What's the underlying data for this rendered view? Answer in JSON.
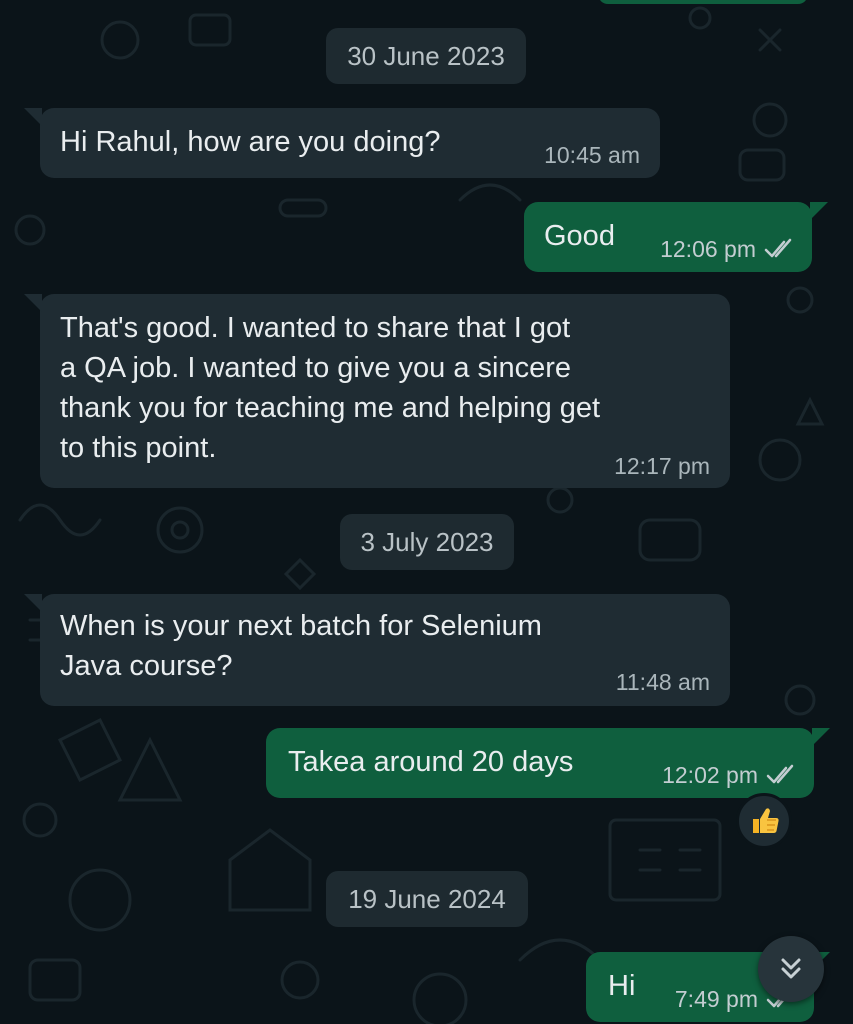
{
  "theme": {
    "background": "#0b1419",
    "incoming_bubble": "#1f2c33",
    "outgoing_bubble": "#0f5f3e",
    "date_chip": "#1e2a30",
    "text": "#e9edef",
    "meta_text": "#aab6bb",
    "tick_color": "#c3cdd1"
  },
  "dates": {
    "d1": "30 June 2023",
    "d2": "3 July 2023",
    "d3": "19 June 2024"
  },
  "messages": [
    {
      "direction": "incoming",
      "text": "Hi Rahul, how are you doing?",
      "time": "10:45 am"
    },
    {
      "direction": "outgoing",
      "text": "Good",
      "time": "12:06 pm",
      "status": "read-ticks"
    },
    {
      "direction": "incoming",
      "text": "That's good. I wanted to share that I got\na QA job. I wanted to give you a sincere\nthank you for teaching me and helping get\nto this point.",
      "time": "12:17 pm"
    },
    {
      "direction": "incoming",
      "text": "When is your next batch for Selenium\nJava course?",
      "time": "11:48 am"
    },
    {
      "direction": "outgoing",
      "text": "Takea around 20 days",
      "time": "12:02 pm",
      "status": "read-ticks",
      "reaction": "thumbs-up"
    },
    {
      "direction": "outgoing",
      "text": "Hi",
      "time": "7:49 pm",
      "status": "read-ticks"
    }
  ],
  "icons": {
    "read_status": "double-check-icon",
    "reaction": "thumbs-up-icon",
    "scroll": "double-chevron-down-icon"
  }
}
